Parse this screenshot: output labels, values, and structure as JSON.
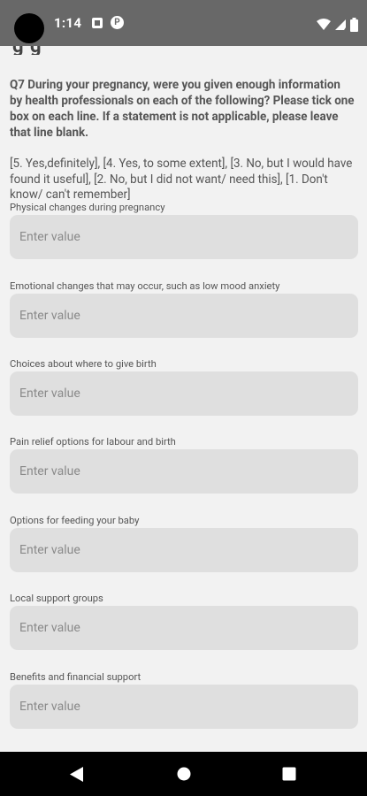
{
  "status_bar": {
    "time": "1:14",
    "notif_icon_2_glyph": "P",
    "icons": [
      "stop-icon",
      "pocket-casts-icon",
      "wifi-icon",
      "signal-icon",
      "battery-icon"
    ]
  },
  "header": {
    "cut_title": "g          g"
  },
  "question": {
    "text": "Q7 During your pregnancy, were you given enough information by health professionals on each of the following? Please tick one box on each line. If a statement is not applicable, please leave that line blank.",
    "legend": "[5. Yes,definitely], [4. Yes, to some extent], [3. No, but I would have found it useful], [2. No, but I did not want/ need this], [1. Don't know/ can't remember]"
  },
  "fields": [
    {
      "label": "Physical changes during pregnancy",
      "placeholder": "Enter value",
      "value": ""
    },
    {
      "label": "Emotional changes that may occur, such as low mood anxiety",
      "placeholder": "Enter value",
      "value": ""
    },
    {
      "label": "Choices about where to give birth",
      "placeholder": "Enter value",
      "value": ""
    },
    {
      "label": "Pain relief options for labour and birth",
      "placeholder": "Enter value",
      "value": ""
    },
    {
      "label": "Options for feeding your baby",
      "placeholder": "Enter value",
      "value": ""
    },
    {
      "label": "Local support groups",
      "placeholder": "Enter value",
      "value": ""
    },
    {
      "label": "Benefits and financial support",
      "placeholder": "Enter value",
      "value": ""
    }
  ],
  "nav_bar": {
    "buttons": [
      "back-icon",
      "home-icon",
      "recents-icon"
    ]
  },
  "colors": {
    "status_bar": "#686868",
    "background": "#f2f2f2",
    "input_fill": "#dfdfdf",
    "nav_bar": "#000000"
  }
}
